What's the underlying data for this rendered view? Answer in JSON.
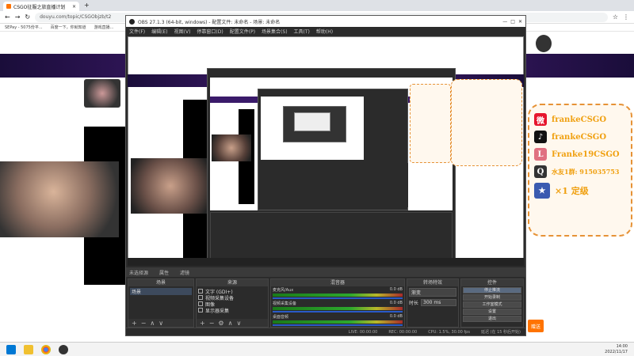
{
  "browser": {
    "tab_title": "CSGO征服之旅直播计划",
    "url": "douyu.com/topic/CSGObjzb/t2",
    "bookmarks": [
      "SEPay - 5075份平...",
      "百度一下，你就知道",
      "游戏直播..."
    ]
  },
  "obs": {
    "title": "OBS 27.1.3 (64-bit, windows) - 配置文件: 未命名 - 场景: 未命名",
    "menu": [
      "文件(F)",
      "编辑(E)",
      "视图(V)",
      "停靠窗口(D)",
      "配置文件(P)",
      "场景集合(S)",
      "工具(T)",
      "帮助(H)"
    ],
    "scene_bar": [
      "未选择源",
      "属性",
      "滤镜"
    ],
    "docks": {
      "scenes": {
        "header": "场景",
        "items": [
          "场景"
        ]
      },
      "sources": {
        "header": "来源",
        "items": [
          "文字 (GDI+)",
          "视频采集设备",
          "图像",
          "显示器采集"
        ]
      },
      "mixer": {
        "header": "混音器",
        "channels": [
          {
            "name": "麦克风/Aux",
            "db": "0.0 dB"
          },
          {
            "name": "视频采集设备",
            "db": "0.0 dB"
          },
          {
            "name": "桌面音频",
            "db": "0.0 dB"
          }
        ]
      },
      "transitions": {
        "header": "转场特效",
        "type": "渐变",
        "duration_label": "时长",
        "duration": "300 ms"
      },
      "controls": {
        "header": "控件",
        "buttons": [
          "停止推流",
          "开始录制",
          "工作室模式",
          "设置",
          "退出"
        ]
      }
    },
    "status": [
      "LIVE: 00:00:00",
      "REC: 00:00:00",
      "CPU: 1.5%, 30.00 fps",
      "延迟 (在 15 秒后开始)"
    ]
  },
  "promo": {
    "lines": [
      {
        "icon": "weibo-icon",
        "text": "frankeCSGO"
      },
      {
        "icon": "tiktok-icon",
        "text": "frankeCSGO"
      },
      {
        "icon": "lolo-icon",
        "text": "Franke19CSGO"
      },
      {
        "icon": "qq-icon",
        "text": "水友1群: 915035753"
      },
      {
        "icon": "rank-icon",
        "text": "×1 定级"
      }
    ]
  },
  "page": {
    "orange_button": "赠送"
  },
  "taskbar": {
    "time": "14:00",
    "date": "2022/11/17"
  },
  "colors": {
    "accent_orange": "#ff7300",
    "promo_text": "#f0a010",
    "banner": "#4a1f7a"
  }
}
